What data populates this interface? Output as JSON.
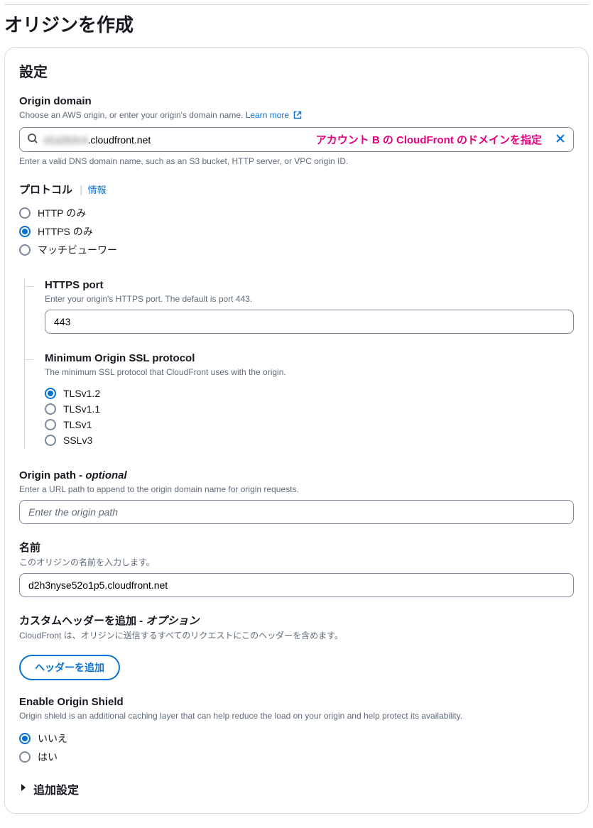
{
  "page": {
    "title": "オリジンを作成"
  },
  "panel": {
    "title": "設定"
  },
  "originDomain": {
    "label": "Origin domain",
    "desc": "Choose an AWS origin, or enter your origin's domain name.",
    "learnMore": "Learn more",
    "value": ".cloudfront.net",
    "blurPrefix": "d1a2b3c4",
    "annotation": "アカウント B の CloudFront のドメインを指定",
    "helper": "Enter a valid DNS domain name, such as an S3 bucket, HTTP server, or VPC origin ID."
  },
  "protocol": {
    "label": "プロトコル",
    "info": "情報",
    "options": {
      "http": "HTTP のみ",
      "https": "HTTPS のみ",
      "match": "マッチビューワー"
    }
  },
  "httpsPort": {
    "label": "HTTPS port",
    "desc": "Enter your origin's HTTPS port. The default is port 443.",
    "value": "443"
  },
  "sslProtocol": {
    "label": "Minimum Origin SSL protocol",
    "desc": "The minimum SSL protocol that CloudFront uses with the origin.",
    "options": {
      "tls12": "TLSv1.2",
      "tls11": "TLSv1.1",
      "tls1": "TLSv1",
      "sslv3": "SSLv3"
    }
  },
  "originPath": {
    "label": "Origin path -",
    "optional": "optional",
    "desc": "Enter a URL path to append to the origin domain name for origin requests.",
    "placeholder": "Enter the origin path"
  },
  "name": {
    "label": "名前",
    "desc": "このオリジンの名前を入力します。",
    "value": "d2h3nyse52o1p5.cloudfront.net"
  },
  "customHeader": {
    "label": "カスタムヘッダーを追加 -",
    "optional": "オプション",
    "desc": "CloudFront は、オリジンに送信するすべてのリクエストにこのヘッダーを含めます。",
    "button": "ヘッダーを追加"
  },
  "originShield": {
    "label": "Enable Origin Shield",
    "desc": "Origin shield is an additional caching layer that can help reduce the load on your origin and help protect its availability.",
    "options": {
      "no": "いいえ",
      "yes": "はい"
    }
  },
  "additional": {
    "label": "追加設定"
  }
}
